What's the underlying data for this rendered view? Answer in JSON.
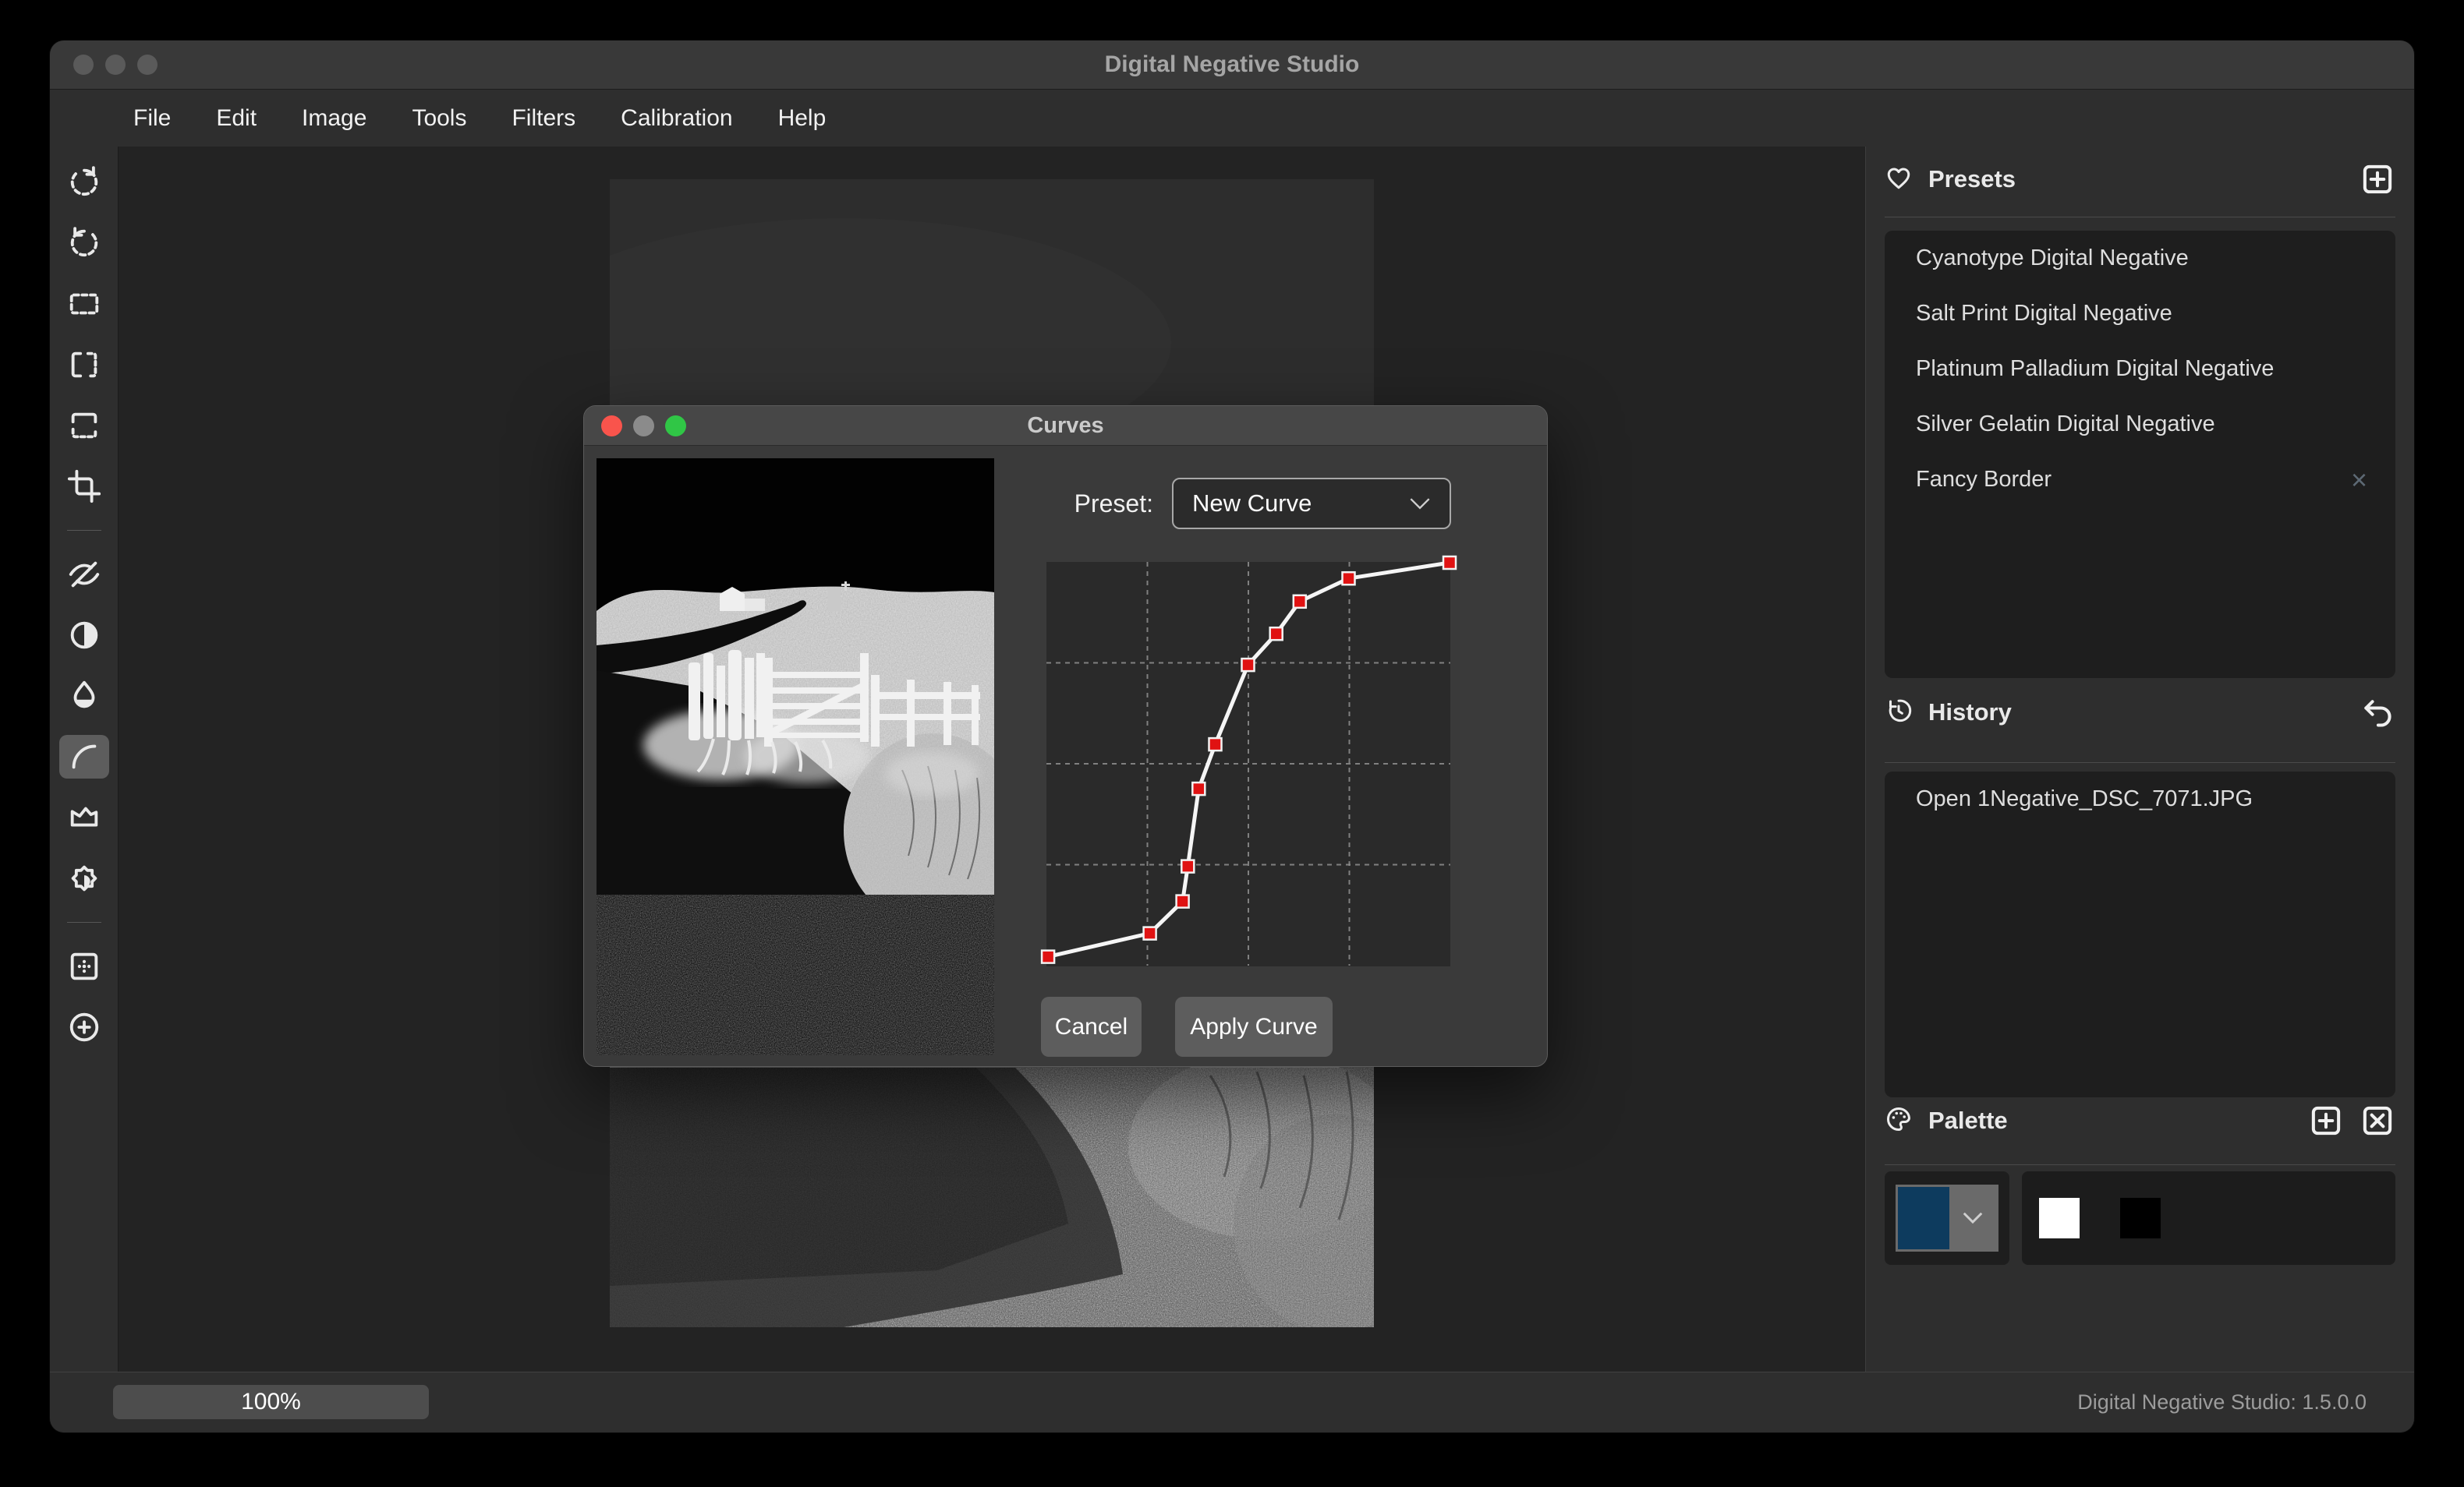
{
  "app": {
    "title": "Digital Negative Studio",
    "version_status": "Digital Negative Studio: 1.5.0.0"
  },
  "menu": {
    "items": [
      "File",
      "Edit",
      "Image",
      "Tools",
      "Filters",
      "Calibration",
      "Help"
    ]
  },
  "toolbar": {
    "active_tool": "curves",
    "tool_icons": [
      "rotate-cw-icon",
      "rotate-ccw-icon",
      "marquee-select-icon",
      "flip-horizontal-icon",
      "flip-vertical-icon",
      "crop-icon",
      "eye-off-icon",
      "contrast-icon",
      "ink-drop-icon",
      "curves-icon",
      "levels-icon",
      "brightness-icon",
      "border-grid-icon",
      "add-circle-icon"
    ]
  },
  "dialog": {
    "title": "Curves",
    "preset_label": "Preset:",
    "preset_value": "New Curve",
    "cancel_label": "Cancel",
    "apply_label": "Apply Curve",
    "curve": {
      "type": "line",
      "grid_divisions": 4,
      "line_color": "#f5f5f5",
      "point_color": "#e01212",
      "points": [
        {
          "x": 0.004,
          "y": 0.022
        },
        {
          "x": 0.256,
          "y": 0.08
        },
        {
          "x": 0.337,
          "y": 0.159
        },
        {
          "x": 0.35,
          "y": 0.246
        },
        {
          "x": 0.377,
          "y": 0.438
        },
        {
          "x": 0.418,
          "y": 0.548
        },
        {
          "x": 0.499,
          "y": 0.745
        },
        {
          "x": 0.569,
          "y": 0.822
        },
        {
          "x": 0.627,
          "y": 0.902
        },
        {
          "x": 0.748,
          "y": 0.959
        },
        {
          "x": 0.998,
          "y": 0.998
        }
      ]
    }
  },
  "sidebar": {
    "presets": {
      "title": "Presets",
      "items": [
        {
          "label": "Cyanotype Digital Negative",
          "removable": false
        },
        {
          "label": "Salt Print Digital Negative",
          "removable": false
        },
        {
          "label": "Platinum Palladium Digital Negative",
          "removable": false
        },
        {
          "label": "Silver Gelatin Digital Negative",
          "removable": false
        },
        {
          "label": "Fancy Border",
          "removable": true
        }
      ],
      "remove_glyph": "×"
    },
    "history": {
      "title": "History",
      "items": [
        {
          "label": "Open 1Negative_DSC_7071.JPG"
        }
      ]
    },
    "palette": {
      "title": "Palette",
      "selected_color": "#0d3b5e",
      "swatches": [
        "#ffffff",
        "#000000"
      ]
    }
  },
  "statusbar": {
    "zoom": "100%"
  }
}
